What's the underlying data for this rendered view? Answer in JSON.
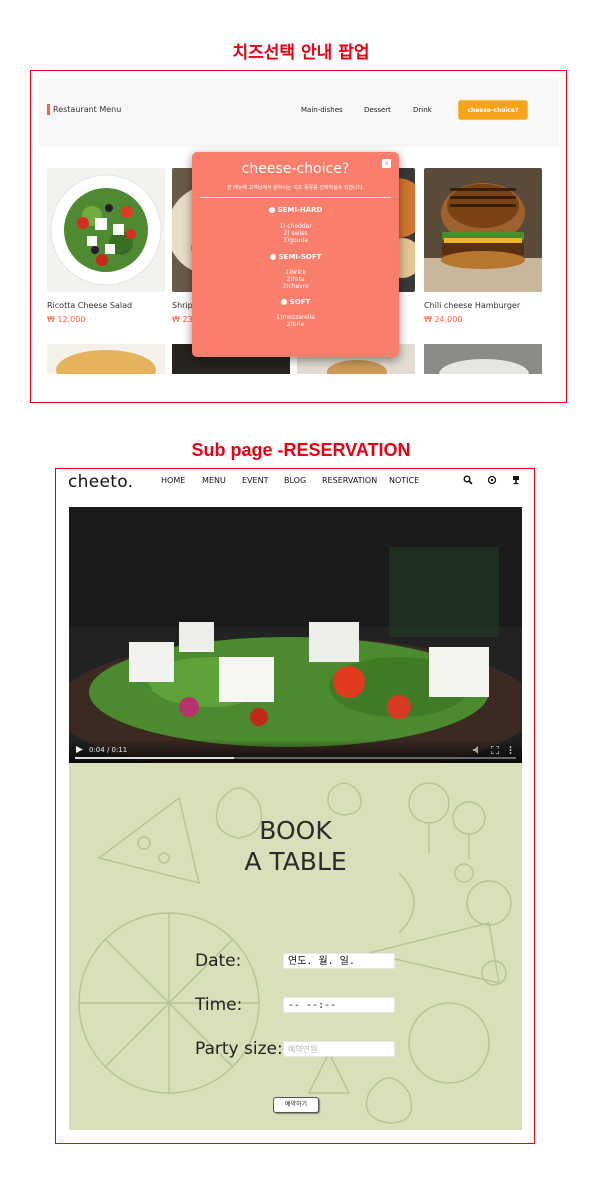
{
  "section1": {
    "heading": "치즈선택 안내 팝업",
    "brand": "Restaurant Menu",
    "nav": [
      "Main-dishes",
      "Dessert",
      "Drink"
    ],
    "cheese_button": "cheese-choice?",
    "cards": [
      {
        "name": "Ricotta Cheese Salad",
        "price": "₩ 12,000"
      },
      {
        "name": "Shrip",
        "price": "₩ 23"
      },
      {
        "name": "Chili cheese Hamburger",
        "price": "₩ 24,000"
      }
    ],
    "modal": {
      "title": "cheese-choice?",
      "close": "x",
      "description": "전 메뉴에 고객님께서 원하시는 치즈 종류를 선택하실수 있습니다.",
      "categories": [
        {
          "name": "SEMI-HARD",
          "items": [
            "1) cheddar",
            "2) swiss",
            "3)gouda"
          ]
        },
        {
          "name": "SEMI-SOFT",
          "items": [
            "1)brick",
            "2)feta",
            "3)chevre"
          ]
        },
        {
          "name": "SOFT",
          "items": [
            "1)mozzarella",
            "2)brie"
          ]
        }
      ]
    },
    "colors": {
      "accent": "#f97e6c",
      "button": "#f7a21b",
      "price": "#ff5a3c"
    }
  },
  "section2": {
    "heading": "Sub page -RESERVATION",
    "logo": "cheeto.",
    "nav": [
      "HOME",
      "MENU",
      "EVENT",
      "BLOG",
      "RESERVATION",
      "NOTICE"
    ],
    "icons": [
      "search-icon",
      "settings-icon",
      "trophy-icon"
    ],
    "video": {
      "time": "0:04 / 0:11",
      "progress": 0.36
    },
    "booking": {
      "title_line1": "BOOK",
      "title_line2": "A TABLE",
      "date_label": "Date:",
      "date_value": "연도. 월. 일.",
      "time_label": "Time:",
      "time_value": "-- --:--",
      "party_label": "Party size:",
      "party_placeholder": "예약인원",
      "submit": "예약하기"
    },
    "colors": {
      "booking_bg": "#d8e0b9"
    }
  }
}
